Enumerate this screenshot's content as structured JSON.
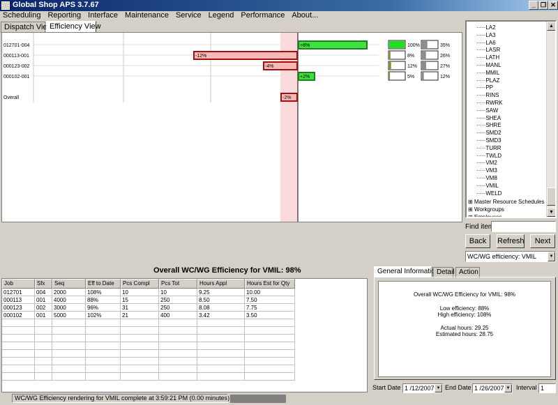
{
  "window": {
    "title": "Global Shop APS 3.7.67",
    "controls": {
      "minimize": "_",
      "restore": "❐",
      "close": "✕"
    }
  },
  "menu": [
    "Scheduling",
    "Reporting",
    "Interface",
    "Maintenance",
    "Service",
    "Legend",
    "Performance",
    "About..."
  ],
  "view_tabs": [
    {
      "label": "Dispatch View",
      "active": false
    },
    {
      "label": "Efficiency View",
      "active": true
    }
  ],
  "chart_data": {
    "type": "bar",
    "orientation": "horizontal",
    "categories": [
      "012701-004",
      "000113-001",
      "000123-002",
      "000102-001",
      "Overall"
    ],
    "values": [
      8,
      -12,
      -4,
      2,
      -2
    ],
    "labels": [
      "+8%",
      "-12%",
      "-4%",
      "+2%",
      "-2%"
    ],
    "range": [
      -30,
      10
    ],
    "colors": {
      "positive": "#40e040",
      "negative": "#f8b8b8",
      "negative_border": "#a01010",
      "positive_border": "#208020",
      "band": "#fadada"
    },
    "progress": [
      {
        "pct1": 100,
        "label1": "100%",
        "pct2": 35,
        "label2": "35%"
      },
      {
        "pct1": 8,
        "label1": "8%",
        "pct2": 26,
        "label2": "26%"
      },
      {
        "pct1": 12,
        "label1": "12%",
        "pct2": 27,
        "label2": "27%"
      },
      {
        "pct1": 5,
        "label1": "5%",
        "pct2": 12,
        "label2": "12%"
      }
    ]
  },
  "tree": {
    "items": [
      "LA2",
      "LA3",
      "LA6",
      "LASR",
      "LATH",
      "MANL",
      "MMIL",
      "PLAZ",
      "PP",
      "RINS",
      "RWRK",
      "SAW",
      "SHEA",
      "SHRE",
      "SMD2",
      "SMD3",
      "TURR",
      "TWLD",
      "VM2",
      "VM3",
      "VM8",
      "VMIL",
      "WELD"
    ],
    "groups": [
      "Master Resource Schedules",
      "Workgroups",
      "Employees"
    ]
  },
  "find": {
    "label": "Find item",
    "value": ""
  },
  "nav_buttons": {
    "back": "Back",
    "refresh": "Refresh",
    "next": "Next"
  },
  "selector": {
    "value": "WC/WG efficiency: VMIL"
  },
  "grid": {
    "title": "Overall WC/WG Efficiency for VMIL: 98%",
    "columns": [
      "Job",
      "Sfx",
      "Seq",
      "Eff to Date",
      "Pcs Compl",
      "Pcs Tot",
      "Hours Appl",
      "Hours Est for Qty"
    ],
    "rows": [
      [
        "012701",
        "004",
        "2000",
        "108%",
        "10",
        "10",
        "9.25",
        "10.00"
      ],
      [
        "000113",
        "001",
        "4000",
        "88%",
        "15",
        "250",
        "8.50",
        "7.50"
      ],
      [
        "000123",
        "002",
        "3000",
        "96%",
        "31",
        "250",
        "8.08",
        "7.75"
      ],
      [
        "000102",
        "001",
        "5000",
        "102%",
        "21",
        "400",
        "3.42",
        "3.50"
      ]
    ]
  },
  "info_tabs": [
    "General Information",
    "Detail",
    "Action"
  ],
  "info": {
    "heading": "Overall WC/WG Efficiency for VMIL: 98%",
    "low": "Low efficiency: 88%",
    "high": "High efficiency: 108%",
    "actual": "Actual hours: 29.25",
    "estimated": "Estimated hours: 28.75"
  },
  "dates": {
    "start_label": "Start Date",
    "start": "1 /12/2007",
    "end_label": "End Date",
    "end": "1 /26/2007",
    "interval_label": "Interval",
    "interval": "1"
  },
  "status": {
    "text": "WC/WG Efficiency rendering for VMIL complete at 3:59:21 PM  (0.00 minutes)"
  }
}
